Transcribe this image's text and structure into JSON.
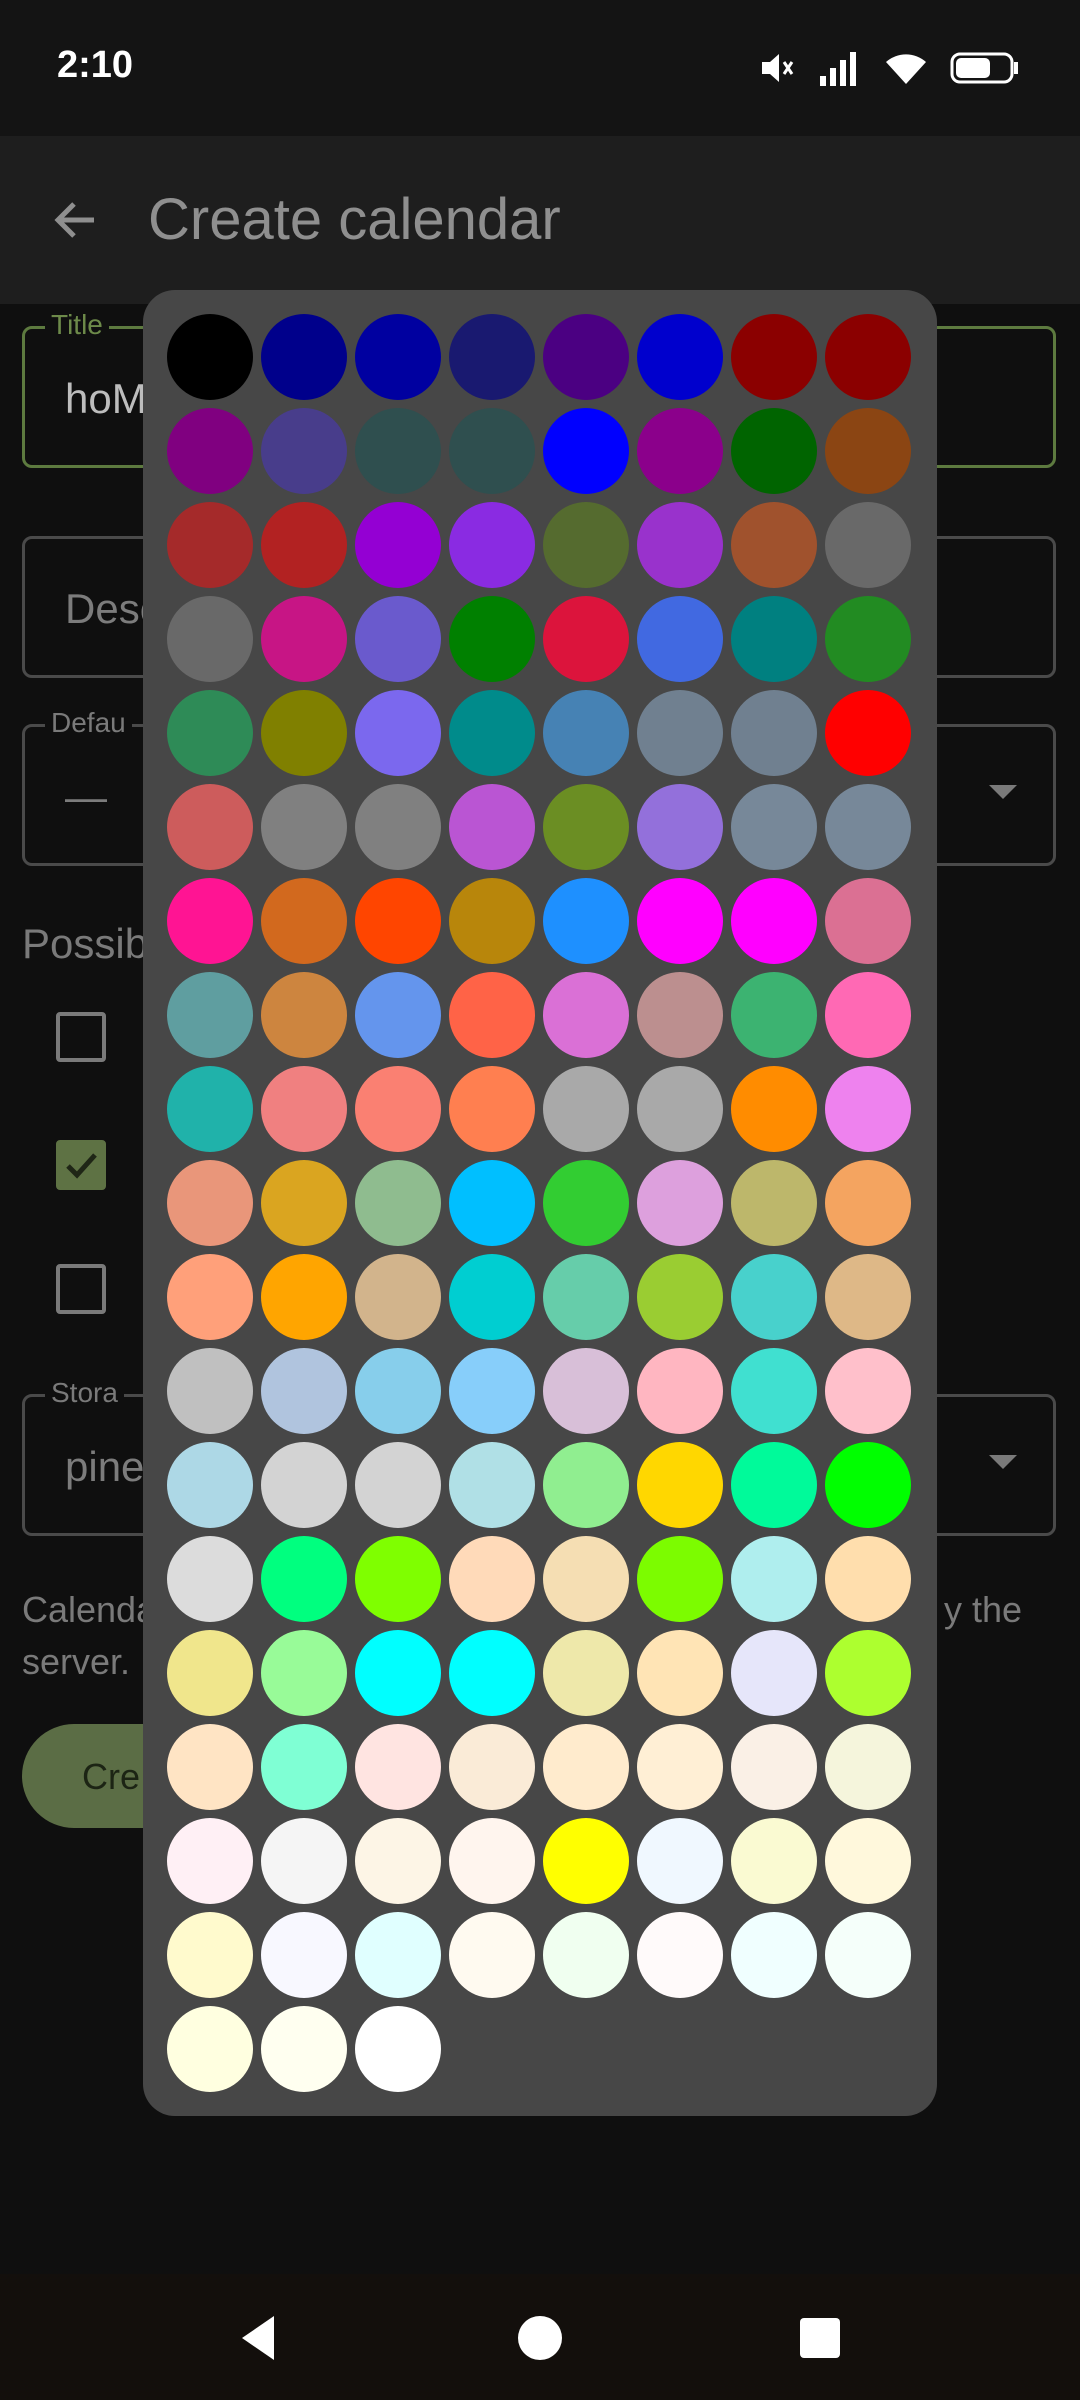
{
  "status_bar": {
    "time": "2:10"
  },
  "app_bar": {
    "title": "Create calendar"
  },
  "form": {
    "title_label": "Title",
    "title_value": "hoM",
    "description_placeholder": "Desc",
    "default_label": "Defau",
    "default_value": "—",
    "possible_label": "Possib",
    "storage_label": "Stora",
    "storage_value": "pine",
    "note_line1": "Calenda",
    "note_line1_end": "y the",
    "note_line2": "server.",
    "create_label": "Cre"
  },
  "color_picker": {
    "colors": [
      "#000000",
      "#00008B",
      "#0000A0",
      "#191970",
      "#4B0082",
      "#0000CD",
      "#8B0000",
      "#8B0000",
      "#800080",
      "#483D8B",
      "#2F4F4F",
      "#2F4F4F",
      "#0000FF",
      "#8B008B",
      "#006400",
      "#8B4513",
      "#A52A2A",
      "#B22222",
      "#9400D3",
      "#8A2BE2",
      "#556B2F",
      "#9932CC",
      "#A0522D",
      "#696969",
      "#696969",
      "#C71585",
      "#6A5ACD",
      "#008000",
      "#DC143C",
      "#4169E1",
      "#008080",
      "#228B22",
      "#2E8B57",
      "#808000",
      "#7B68EE",
      "#008B8B",
      "#4682B4",
      "#708090",
      "#708090",
      "#FF0000",
      "#CD5C5C",
      "#808080",
      "#808080",
      "#BA55D3",
      "#6B8E23",
      "#9370DB",
      "#778899",
      "#778899",
      "#FF1493",
      "#D2691E",
      "#FF4500",
      "#B8860B",
      "#1E90FF",
      "#FF00FF",
      "#FF00FF",
      "#DB7093",
      "#5F9EA0",
      "#CD853F",
      "#6495ED",
      "#FF6347",
      "#DA70D6",
      "#BC8F8F",
      "#3CB371",
      "#FF69B4",
      "#20B2AA",
      "#F08080",
      "#FA8072",
      "#FF7F50",
      "#A9A9A9",
      "#A9A9A9",
      "#FF8C00",
      "#EE82EE",
      "#E9967A",
      "#DAA520",
      "#8FBC8F",
      "#00BFFF",
      "#32CD32",
      "#DDA0DD",
      "#BDB76B",
      "#F4A460",
      "#FFA07A",
      "#FFA500",
      "#D2B48C",
      "#00CED1",
      "#66CDAA",
      "#9ACD32",
      "#48D1CC",
      "#DEB887",
      "#C0C0C0",
      "#B0C4DE",
      "#87CEEB",
      "#87CEFA",
      "#D8BFD8",
      "#FFB6C1",
      "#40E0D0",
      "#FFC0CB",
      "#ADD8E6",
      "#D3D3D3",
      "#D3D3D3",
      "#B0E0E6",
      "#90EE90",
      "#FFD700",
      "#00FA9A",
      "#00FF00",
      "#DCDCDC",
      "#00FF7F",
      "#7FFF00",
      "#FFDAB9",
      "#F5DEB3",
      "#7CFC00",
      "#AFEEEE",
      "#FFDEAD",
      "#F0E68C",
      "#98FB98",
      "#00FFFF",
      "#00FFFF",
      "#EEE8AA",
      "#FFE4B5",
      "#E6E6FA",
      "#ADFF2F",
      "#FFE4C4",
      "#7FFFD4",
      "#FFE4E1",
      "#FAEBD7",
      "#FFEBCD",
      "#FFEFD5",
      "#FAF0E6",
      "#F5F5DC",
      "#FFF0F5",
      "#F5F5F5",
      "#FDF5E6",
      "#FFF5EE",
      "#FFFF00",
      "#F0F8FF",
      "#FAFAD2",
      "#FFF8DC",
      "#FFFACD",
      "#F8F8FF",
      "#E0FFFF",
      "#FFFAF0",
      "#F0FFF0",
      "#FFFAFA",
      "#F0FFFF",
      "#F5FFFA",
      "#FFFFE0",
      "#FFFFF0",
      "#FFFFFF"
    ]
  }
}
